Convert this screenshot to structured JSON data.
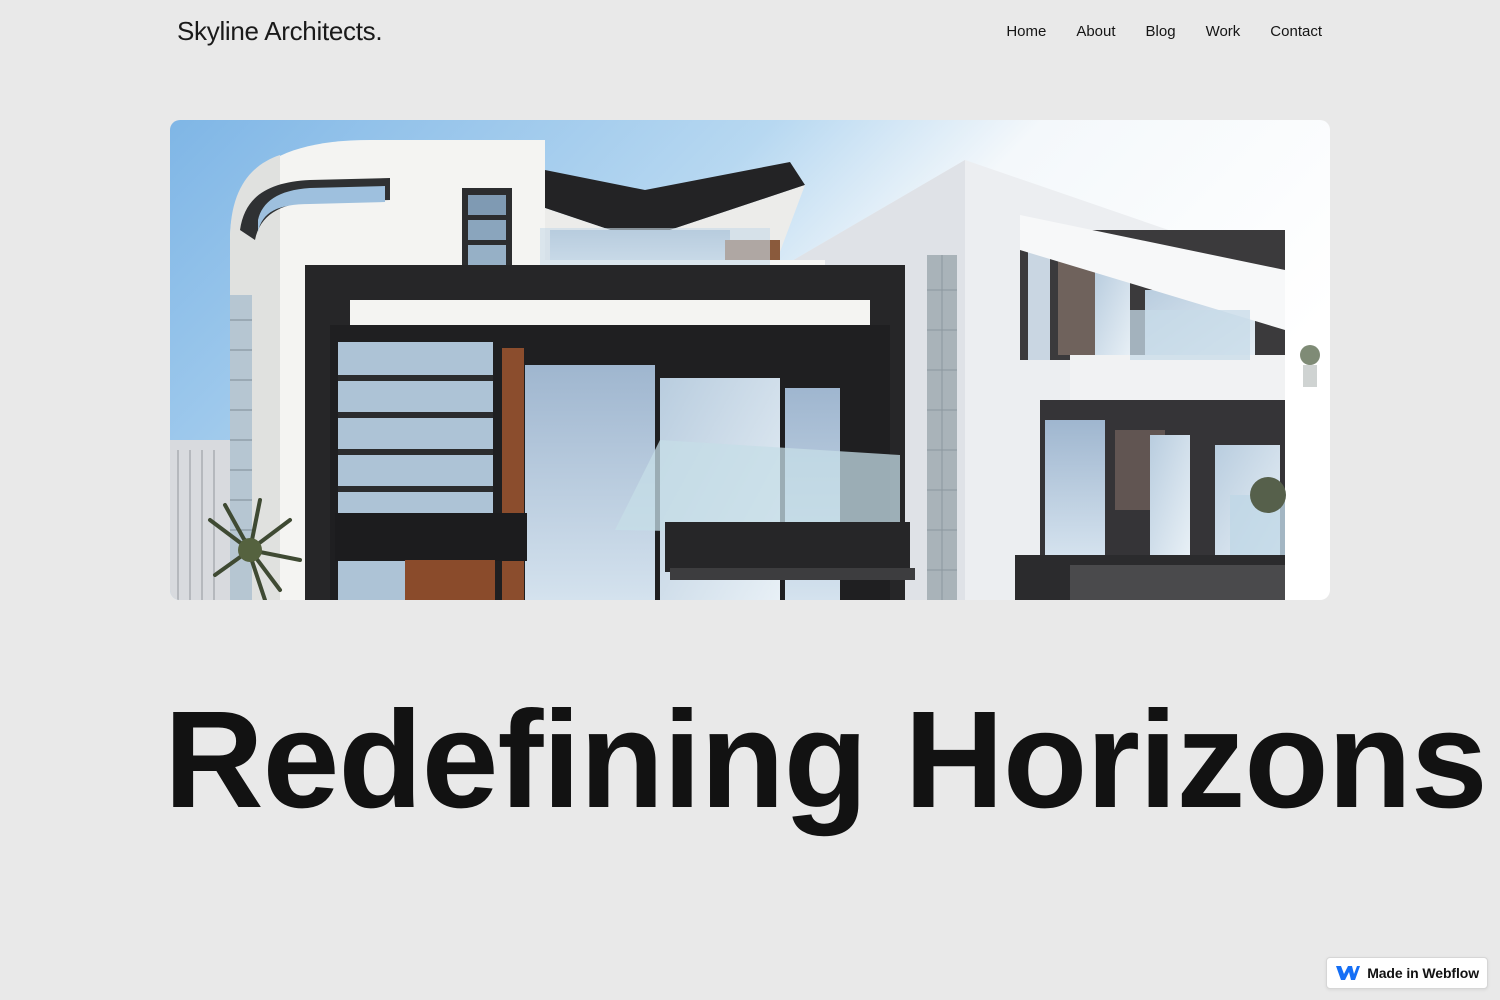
{
  "header": {
    "brand": "Skyline Architects.",
    "nav": [
      {
        "label": "Home"
      },
      {
        "label": "About"
      },
      {
        "label": "Blog"
      },
      {
        "label": "Work"
      },
      {
        "label": "Contact"
      }
    ]
  },
  "hero": {
    "image_subject": "modern white and black residential buildings with glass balconies against a blue sky"
  },
  "headline": "Redefining Horizons",
  "badge": {
    "label": "Made in Webflow",
    "icon": "webflow-logo-icon"
  },
  "colors": {
    "background": "#e9e9e9",
    "text": "#121212",
    "badge_icon": "#146ef5"
  }
}
